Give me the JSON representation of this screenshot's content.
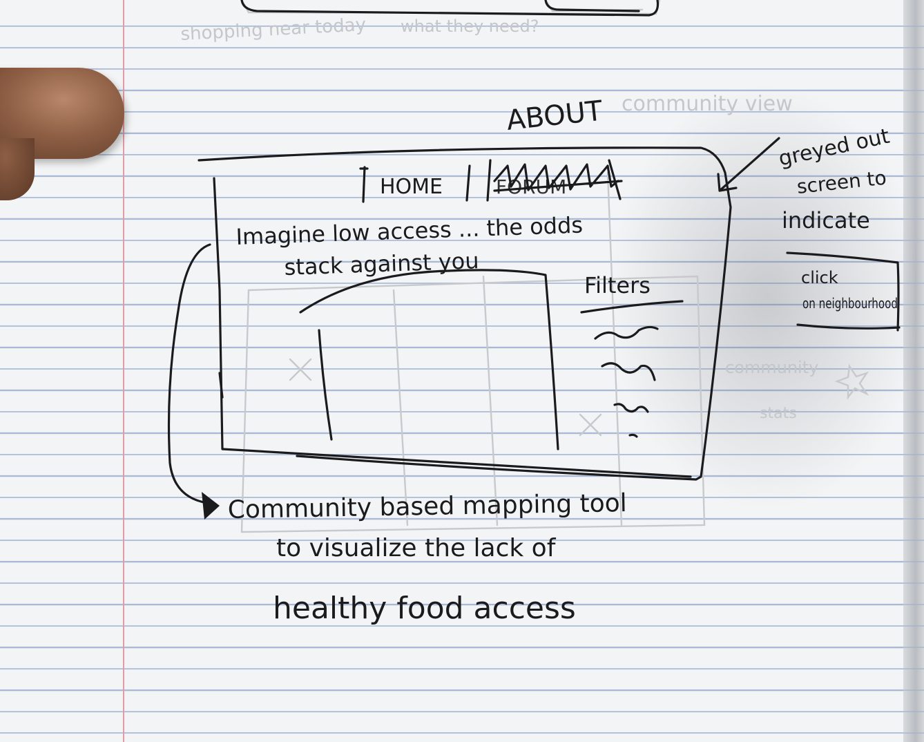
{
  "sketch": {
    "heading": "ABOUT",
    "nav": {
      "home": "HOME",
      "crossed_tab": "FORUM"
    },
    "tagline_line1": "Imagine low access ... the odds",
    "tagline_line2": "stack against you",
    "filters_label": "Filters",
    "side_note": {
      "line1": "greyed out",
      "line2": "screen to",
      "line3": "indicate"
    },
    "click_note": {
      "line1": "click",
      "line2": "on neighbourhood"
    },
    "caption": {
      "line1": "Community based mapping tool",
      "line2": "to visualize the lack of",
      "line3": "healthy food access"
    }
  },
  "background_sketch": {
    "line1": "shopping near today",
    "line2": "what they need?",
    "line3": "community view",
    "line4": "community",
    "line5": "stats"
  },
  "colors": {
    "ink": "#1b1b1d",
    "paper": "#f3f4f5",
    "rule_lines": "#a9b9d6",
    "margin_line": "#e39aa0",
    "skin": "#8d5e44"
  }
}
